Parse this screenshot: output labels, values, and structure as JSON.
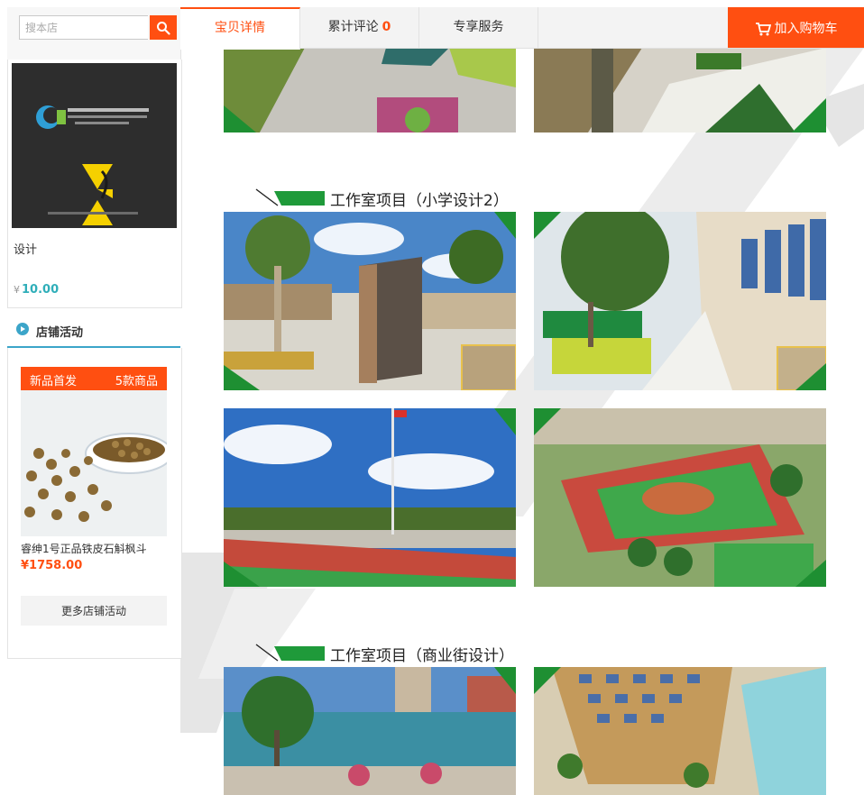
{
  "search": {
    "placeholder": "搜本店"
  },
  "product": {
    "name": "设计",
    "price_symbol": "¥",
    "price": "10.00"
  },
  "activity": {
    "title": "店铺活动",
    "banner_left": "新品首发",
    "banner_right": "5款商品",
    "item_name": "睿绅1号正品铁皮石斛枫斗",
    "item_price": "¥1758.00",
    "more_label": "更多店铺活动"
  },
  "tabs": [
    {
      "label": "宝贝详情",
      "active": true
    },
    {
      "label": "累计评论",
      "count": "0"
    },
    {
      "label": "专享服务"
    }
  ],
  "cart": {
    "label": "加入购物车"
  },
  "sections": [
    {
      "title": "工作室项目（小学设计2）"
    },
    {
      "title": "工作室项目（商业街设计）"
    }
  ],
  "colors": {
    "accent": "#ff4f11",
    "teal": "#3ca5c9",
    "green": "#1f9a3a"
  }
}
